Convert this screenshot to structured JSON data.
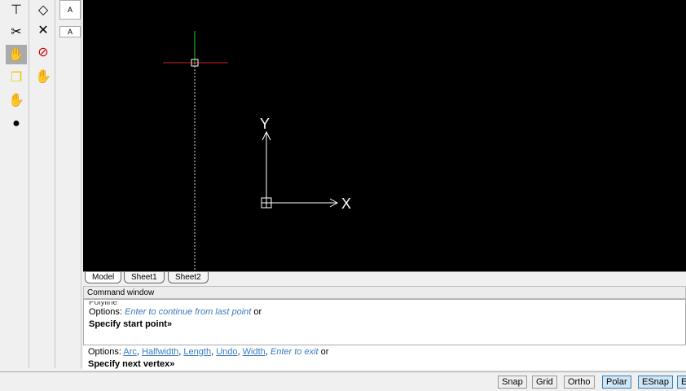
{
  "tabs": [
    "Model",
    "Sheet1",
    "Sheet2"
  ],
  "command_window": {
    "title": "Command window",
    "history": {
      "cut_line": "Polyline",
      "options_label": "Options:",
      "option_italic": "Enter to continue from last point",
      "or": "or",
      "prompt": "Specify start point»"
    },
    "current": {
      "options_label": "Options:",
      "options": [
        "Arc",
        "Halfwidth",
        "Length",
        "Undo",
        "Width"
      ],
      "option_italic": "Enter to exit",
      "or": "or",
      "prompt": "Specify next vertex»"
    }
  },
  "ucs": {
    "x_label": "X",
    "y_label": "Y"
  },
  "status_buttons": [
    {
      "label": "Snap",
      "on": false
    },
    {
      "label": "Grid",
      "on": false
    },
    {
      "label": "Ortho",
      "on": false
    },
    {
      "label": "Polar",
      "on": true
    },
    {
      "label": "ESnap",
      "on": true
    },
    {
      "label": "ET",
      "on": true
    }
  ],
  "text_tool_label": "A"
}
